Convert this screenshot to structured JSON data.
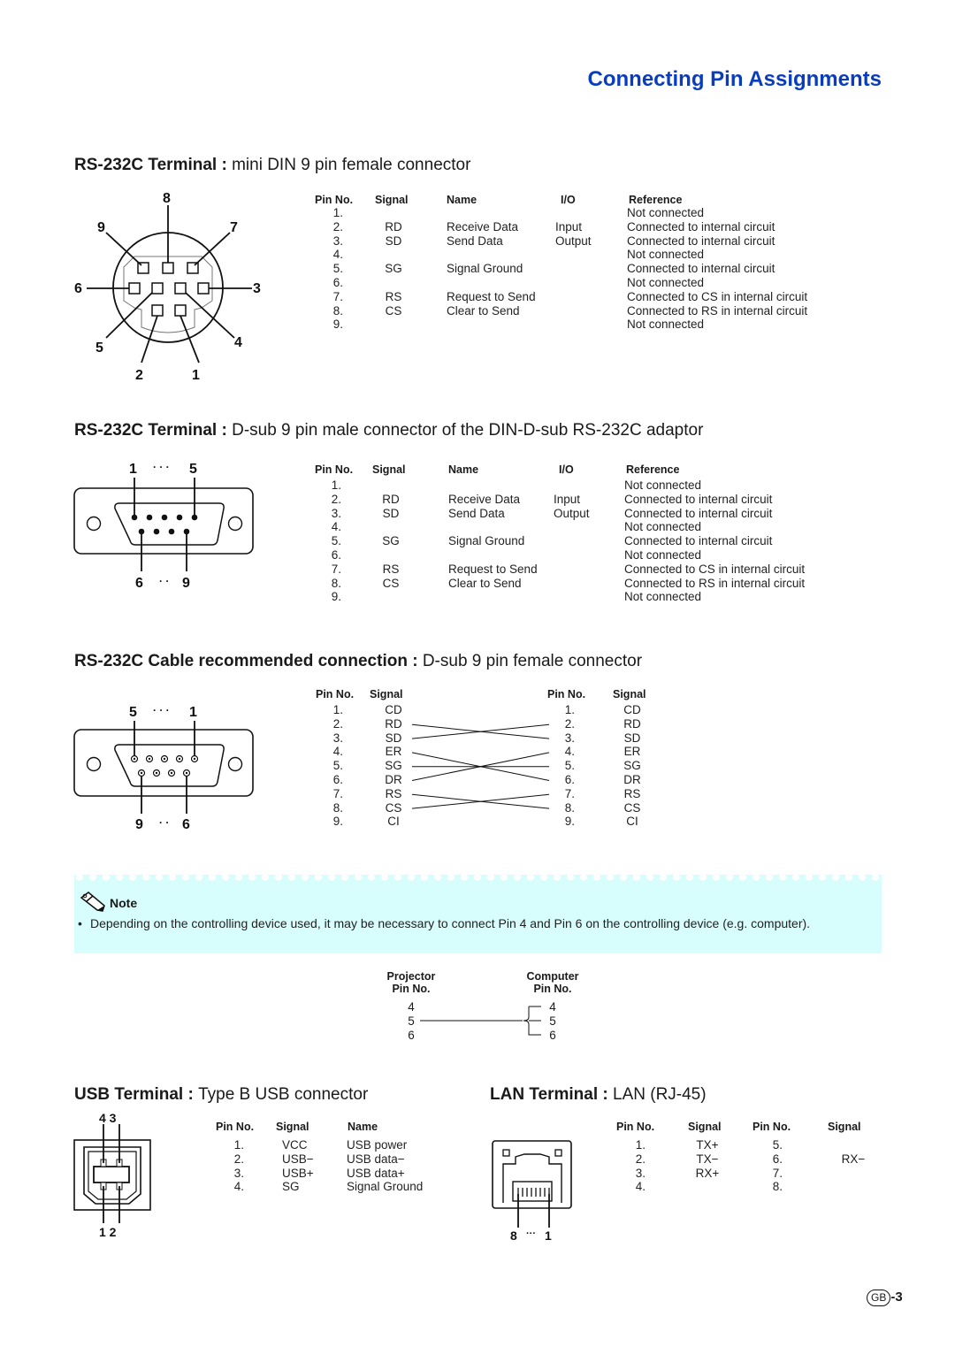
{
  "page_title": "Connecting Pin Assignments",
  "page_number": {
    "badge": "GB",
    "suffix": "-3"
  },
  "sections": {
    "din": {
      "heading_bold": "RS-232C Terminal",
      "sep": " : ",
      "heading_rest": "mini DIN 9 pin female connector",
      "diagram_labels": [
        "8",
        "9",
        "7",
        "6",
        "3",
        "5",
        "4",
        "2",
        "1"
      ],
      "headers": {
        "pin": "Pin No.",
        "signal": "Signal",
        "name": "Name",
        "io": "I/O",
        "ref": "Reference"
      },
      "rows": [
        {
          "pin": "1.",
          "signal": "",
          "name": "",
          "io": "",
          "ref": "Not connected"
        },
        {
          "pin": "2.",
          "signal": "RD",
          "name": "Receive Data",
          "io": "Input",
          "ref": "Connected to internal circuit"
        },
        {
          "pin": "3.",
          "signal": "SD",
          "name": "Send Data",
          "io": "Output",
          "ref": "Connected to internal circuit"
        },
        {
          "pin": "4.",
          "signal": "",
          "name": "",
          "io": "",
          "ref": "Not connected"
        },
        {
          "pin": "5.",
          "signal": "SG",
          "name": "Signal Ground",
          "io": "",
          "ref": "Connected to internal circuit"
        },
        {
          "pin": "6.",
          "signal": "",
          "name": "",
          "io": "",
          "ref": "Not connected"
        },
        {
          "pin": "7.",
          "signal": "RS",
          "name": "Request to Send",
          "io": "",
          "ref": "Connected to CS in internal circuit"
        },
        {
          "pin": "8.",
          "signal": "CS",
          "name": "Clear to Send",
          "io": "",
          "ref": "Connected to RS in internal circuit"
        },
        {
          "pin": "9.",
          "signal": "",
          "name": "",
          "io": "",
          "ref": "Not connected"
        }
      ]
    },
    "dsub_male": {
      "heading_bold": "RS-232C Terminal",
      "sep": " : ",
      "heading_rest": "D-sub 9 pin male connector of the DIN-D-sub RS-232C adaptor",
      "diagram_labels": {
        "top_left": "1",
        "top_dots": "· · ·",
        "top_right": "5",
        "bottom_left": "6",
        "bottom_dots": "· ·",
        "bottom_right": "9"
      },
      "headers": {
        "pin": "Pin No.",
        "signal": "Signal",
        "name": "Name",
        "io": "I/O",
        "ref": "Reference"
      },
      "rows": [
        {
          "pin": "1.",
          "signal": "",
          "name": "",
          "io": "",
          "ref": "Not connected"
        },
        {
          "pin": "2.",
          "signal": "RD",
          "name": "Receive Data",
          "io": "Input",
          "ref": "Connected to internal circuit"
        },
        {
          "pin": "3.",
          "signal": "SD",
          "name": "Send Data",
          "io": "Output",
          "ref": "Connected to internal circuit"
        },
        {
          "pin": "4.",
          "signal": "",
          "name": "",
          "io": "",
          "ref": "Not connected"
        },
        {
          "pin": "5.",
          "signal": "SG",
          "name": "Signal Ground",
          "io": "",
          "ref": "Connected to internal circuit"
        },
        {
          "pin": "6.",
          "signal": "",
          "name": "",
          "io": "",
          "ref": "Not connected"
        },
        {
          "pin": "7.",
          "signal": "RS",
          "name": "Request to Send",
          "io": "",
          "ref": "Connected to CS in internal circuit"
        },
        {
          "pin": "8.",
          "signal": "CS",
          "name": "Clear to Send",
          "io": "",
          "ref": "Connected to RS in internal circuit"
        },
        {
          "pin": "9.",
          "signal": "",
          "name": "",
          "io": "",
          "ref": "Not connected"
        }
      ]
    },
    "cable": {
      "heading_bold": "RS-232C Cable recommended connection",
      "sep": " : ",
      "heading_rest": "D-sub 9 pin female connector",
      "diagram_labels": {
        "top_left": "5",
        "top_dots": "· · ·",
        "top_right": "1",
        "bottom_left": "9",
        "bottom_dots": "· ·",
        "bottom_right": "6"
      },
      "headers": {
        "pin": "Pin No.",
        "signal": "Signal"
      },
      "left": [
        {
          "pin": "1.",
          "signal": "CD"
        },
        {
          "pin": "2.",
          "signal": "RD"
        },
        {
          "pin": "3.",
          "signal": "SD"
        },
        {
          "pin": "4.",
          "signal": "ER"
        },
        {
          "pin": "5.",
          "signal": "SG"
        },
        {
          "pin": "6.",
          "signal": "DR"
        },
        {
          "pin": "7.",
          "signal": "RS"
        },
        {
          "pin": "8.",
          "signal": "CS"
        },
        {
          "pin": "9.",
          "signal": "CI"
        }
      ],
      "right": [
        {
          "pin": "1.",
          "signal": "CD"
        },
        {
          "pin": "2.",
          "signal": "RD"
        },
        {
          "pin": "3.",
          "signal": "SD"
        },
        {
          "pin": "4.",
          "signal": "ER"
        },
        {
          "pin": "5.",
          "signal": "SG"
        },
        {
          "pin": "6.",
          "signal": "DR"
        },
        {
          "pin": "7.",
          "signal": "RS"
        },
        {
          "pin": "8.",
          "signal": "CS"
        },
        {
          "pin": "9.",
          "signal": "CI"
        }
      ],
      "wiring": [
        [
          2,
          3
        ],
        [
          3,
          2
        ],
        [
          4,
          6
        ],
        [
          5,
          5
        ],
        [
          6,
          4
        ],
        [
          7,
          8
        ],
        [
          8,
          7
        ]
      ]
    },
    "note": {
      "title": "Note",
      "bullet": "•",
      "text": "Depending on the controlling device used, it may be necessary to connect Pin 4 and Pin 6 on the controlling device (e.g. computer)."
    },
    "loopback": {
      "left_header": [
        "Projector",
        "Pin No."
      ],
      "right_header": [
        "Computer",
        "Pin No."
      ],
      "left_pins": [
        "4",
        "5",
        "6"
      ],
      "right_pins": [
        "4",
        "5",
        "6"
      ]
    },
    "usb": {
      "heading_bold": "USB Terminal",
      "sep": " : ",
      "heading_rest": "Type B USB connector",
      "diagram_labels": {
        "top": "4 3",
        "bottom": "1 2"
      },
      "headers": {
        "pin": "Pin No.",
        "signal": "Signal",
        "name": "Name"
      },
      "rows": [
        {
          "pin": "1.",
          "signal": "VCC",
          "name": "USB power"
        },
        {
          "pin": "2.",
          "signal": "USB−",
          "name": "USB data−"
        },
        {
          "pin": "3.",
          "signal": "USB+",
          "name": "USB data+"
        },
        {
          "pin": "4.",
          "signal": "SG",
          "name": "Signal Ground"
        }
      ]
    },
    "lan": {
      "heading_bold": "LAN Terminal",
      "sep": " : ",
      "heading_rest": "LAN (RJ-45)",
      "diagram_labels": {
        "left": "8",
        "dots": "···",
        "right": "1"
      },
      "headers": {
        "pin": "Pin No.",
        "signal": "Signal",
        "pin2": "Pin No.",
        "signal2": "Signal"
      },
      "rows": [
        {
          "pin": "1.",
          "signal": "TX+",
          "pin2": "5.",
          "signal2": ""
        },
        {
          "pin": "2.",
          "signal": "TX−",
          "pin2": "6.",
          "signal2": "RX−"
        },
        {
          "pin": "3.",
          "signal": "RX+",
          "pin2": "7.",
          "signal2": ""
        },
        {
          "pin": "4.",
          "signal": "",
          "pin2": "8.",
          "signal2": ""
        }
      ]
    }
  }
}
